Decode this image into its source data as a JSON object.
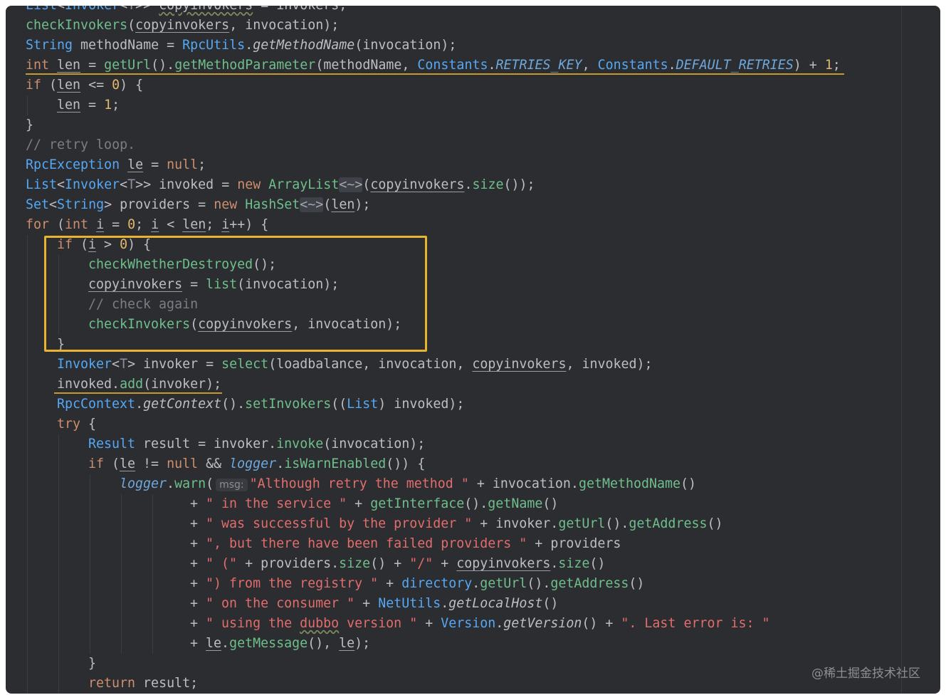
{
  "lines": [
    {
      "i": 0,
      "t": [
        [
          "ty",
          "List"
        ],
        [
          "",
          "<"
        ],
        [
          "ty",
          "Invoker"
        ],
        [
          "",
          "<"
        ],
        [
          "gen",
          "T"
        ],
        [
          "",
          ">> "
        ],
        [
          "ul wavy",
          "copyinvokers"
        ],
        [
          "",
          " = invokers;"
        ]
      ]
    },
    {
      "i": 0,
      "t": [
        [
          "fn",
          "checkInvokers"
        ],
        [
          "",
          "("
        ],
        [
          "ul",
          "copyinvokers"
        ],
        [
          "",
          ", invocation);"
        ]
      ]
    },
    {
      "i": 0,
      "t": [
        [
          "ty",
          "String"
        ],
        [
          "",
          " methodName = "
        ],
        [
          "ty",
          "RpcUtils"
        ],
        [
          "",
          "."
        ],
        [
          "it",
          "getMethodName"
        ],
        [
          "",
          "(invocation);"
        ]
      ]
    },
    {
      "i": 0,
      "t": [
        [
          "kw",
          "int"
        ],
        [
          "",
          " "
        ],
        [
          "ul",
          "len"
        ],
        [
          "",
          " = "
        ],
        [
          "fn",
          "getUrl"
        ],
        [
          "",
          "()."
        ],
        [
          "fn",
          "getMethodParameter"
        ],
        [
          "",
          "(methodName, "
        ],
        [
          "ty",
          "Constants"
        ],
        [
          "",
          "."
        ],
        [
          "cst",
          "RETRIES_KEY"
        ],
        [
          "",
          ", "
        ],
        [
          "ty",
          "Constants"
        ],
        [
          "",
          "."
        ],
        [
          "cst",
          "DEFAULT_RETRIES"
        ],
        [
          "",
          ") + "
        ],
        [
          "nu",
          "1"
        ],
        [
          "",
          ";"
        ]
      ]
    },
    {
      "i": 0,
      "t": [
        [
          "kw",
          "if"
        ],
        [
          "",
          " ("
        ],
        [
          "ul",
          "len"
        ],
        [
          "",
          " <= "
        ],
        [
          "nu",
          "0"
        ],
        [
          "",
          ") {"
        ]
      ]
    },
    {
      "i": 1,
      "t": [
        [
          "ul",
          "len"
        ],
        [
          "",
          " = "
        ],
        [
          "nu",
          "1"
        ],
        [
          "",
          ";"
        ]
      ]
    },
    {
      "i": 0,
      "t": [
        [
          "",
          "}"
        ]
      ]
    },
    {
      "i": 0,
      "t": [
        [
          "co",
          "// retry loop."
        ]
      ]
    },
    {
      "i": 0,
      "t": [
        [
          "ty",
          "RpcException"
        ],
        [
          "",
          " "
        ],
        [
          "ul",
          "le"
        ],
        [
          "",
          " = "
        ],
        [
          "kw",
          "null"
        ],
        [
          "",
          ";"
        ]
      ]
    },
    {
      "i": 0,
      "t": [
        [
          "ty",
          "List"
        ],
        [
          "",
          "<"
        ],
        [
          "ty",
          "Invoker"
        ],
        [
          "",
          "<"
        ],
        [
          "gen",
          "T"
        ],
        [
          "",
          ">> invoked = "
        ],
        [
          "kw",
          "new"
        ],
        [
          "",
          " "
        ],
        [
          "fn",
          "ArrayList"
        ],
        [
          "diamond",
          "<~>"
        ],
        [
          "",
          "("
        ],
        [
          "ul",
          "copyinvokers"
        ],
        [
          "",
          "."
        ],
        [
          "fn",
          "size"
        ],
        [
          "",
          "());"
        ]
      ]
    },
    {
      "i": 0,
      "t": [
        [
          "ty",
          "Set"
        ],
        [
          "",
          "<"
        ],
        [
          "ty",
          "String"
        ],
        [
          "",
          "> providers = "
        ],
        [
          "kw",
          "new"
        ],
        [
          "",
          " "
        ],
        [
          "fn",
          "HashSet"
        ],
        [
          "diamond",
          "<~>"
        ],
        [
          "",
          "("
        ],
        [
          "ul",
          "len"
        ],
        [
          "",
          ");"
        ]
      ]
    },
    {
      "i": 0,
      "t": [
        [
          "kw",
          "for"
        ],
        [
          "",
          " ("
        ],
        [
          "kw",
          "int"
        ],
        [
          "",
          " "
        ],
        [
          "ul",
          "i"
        ],
        [
          "",
          " = "
        ],
        [
          "nu",
          "0"
        ],
        [
          "",
          "; "
        ],
        [
          "ul",
          "i"
        ],
        [
          "",
          " < "
        ],
        [
          "ul",
          "len"
        ],
        [
          "",
          "; "
        ],
        [
          "ul",
          "i"
        ],
        [
          "",
          "++) {"
        ]
      ]
    },
    {
      "i": 1,
      "t": [
        [
          "kw",
          "if"
        ],
        [
          "",
          " ("
        ],
        [
          "ul",
          "i"
        ],
        [
          "",
          " > "
        ],
        [
          "nu",
          "0"
        ],
        [
          "",
          ") {"
        ]
      ]
    },
    {
      "i": 2,
      "t": [
        [
          "fn",
          "checkWhetherDestroyed"
        ],
        [
          "",
          "();"
        ]
      ]
    },
    {
      "i": 2,
      "t": [
        [
          "ul",
          "copyinvokers"
        ],
        [
          "",
          " = "
        ],
        [
          "fn",
          "list"
        ],
        [
          "",
          "(invocation);"
        ]
      ]
    },
    {
      "i": 2,
      "t": [
        [
          "co",
          "// check again"
        ]
      ]
    },
    {
      "i": 2,
      "t": [
        [
          "fn",
          "checkInvokers"
        ],
        [
          "",
          "("
        ],
        [
          "ul",
          "copyinvokers"
        ],
        [
          "",
          ", invocation);"
        ]
      ]
    },
    {
      "i": 1,
      "t": [
        [
          "",
          "}"
        ]
      ]
    },
    {
      "i": 1,
      "t": [
        [
          "ty",
          "Invoker"
        ],
        [
          "",
          "<"
        ],
        [
          "gen",
          "T"
        ],
        [
          "",
          "> invoker = "
        ],
        [
          "fn",
          "select"
        ],
        [
          "",
          "(loadbalance, invocation, "
        ],
        [
          "ul",
          "copyinvokers"
        ],
        [
          "",
          ", invoked);"
        ]
      ]
    },
    {
      "i": 1,
      "t": [
        [
          "",
          "invoked."
        ],
        [
          "fn",
          "add"
        ],
        [
          "",
          "(invoker);"
        ]
      ]
    },
    {
      "i": 1,
      "t": [
        [
          "ty",
          "RpcContext"
        ],
        [
          "",
          "."
        ],
        [
          "it",
          "getContext"
        ],
        [
          "",
          "()."
        ],
        [
          "fn",
          "setInvokers"
        ],
        [
          "",
          "(("
        ],
        [
          "ty",
          "List"
        ],
        [
          "",
          ") invoked);"
        ]
      ]
    },
    {
      "i": 1,
      "t": [
        [
          "kw",
          "try"
        ],
        [
          "",
          " {"
        ]
      ]
    },
    {
      "i": 2,
      "t": [
        [
          "ty",
          "Result"
        ],
        [
          "",
          " result = invoker."
        ],
        [
          "fn",
          "invoke"
        ],
        [
          "",
          "(invocation);"
        ]
      ]
    },
    {
      "i": 2,
      "t": [
        [
          "kw",
          "if"
        ],
        [
          "",
          " ("
        ],
        [
          "ul",
          "le"
        ],
        [
          "",
          " != "
        ],
        [
          "kw",
          "null"
        ],
        [
          "",
          " && "
        ],
        [
          "cst",
          "logger"
        ],
        [
          "",
          "."
        ],
        [
          "fn",
          "isWarnEnabled"
        ],
        [
          "",
          "()) {"
        ]
      ]
    },
    {
      "i": 3,
      "t": [
        [
          "cst",
          "logger"
        ],
        [
          "",
          "."
        ],
        [
          "fn",
          "warn"
        ],
        [
          "",
          "("
        ],
        [
          "hint",
          "msg:"
        ],
        [
          "st",
          "\"Although retry the method \""
        ],
        [
          "",
          " + invocation."
        ],
        [
          "fn",
          "getMethodName"
        ],
        [
          "",
          "()"
        ]
      ]
    },
    {
      "i": 5,
      "t": [
        [
          "",
          " + "
        ],
        [
          "st",
          "\" in the service \""
        ],
        [
          "",
          " + "
        ],
        [
          "fn",
          "getInterface"
        ],
        [
          "",
          "()."
        ],
        [
          "fn",
          "getName"
        ],
        [
          "",
          "()"
        ]
      ]
    },
    {
      "i": 5,
      "t": [
        [
          "",
          " + "
        ],
        [
          "st",
          "\" was successful by the provider \""
        ],
        [
          "",
          " + invoker."
        ],
        [
          "fn",
          "getUrl"
        ],
        [
          "",
          "()."
        ],
        [
          "fn",
          "getAddress"
        ],
        [
          "",
          "()"
        ]
      ]
    },
    {
      "i": 5,
      "t": [
        [
          "",
          " + "
        ],
        [
          "st",
          "\", but there have been failed providers \""
        ],
        [
          "",
          " + providers"
        ]
      ]
    },
    {
      "i": 5,
      "t": [
        [
          "",
          " + "
        ],
        [
          "st",
          "\" (\""
        ],
        [
          "",
          " + providers."
        ],
        [
          "fn",
          "size"
        ],
        [
          "",
          "() + "
        ],
        [
          "st",
          "\"/\""
        ],
        [
          "",
          " + "
        ],
        [
          "ul",
          "copyinvokers"
        ],
        [
          "",
          "."
        ],
        [
          "fn",
          "size"
        ],
        [
          "",
          "()"
        ]
      ]
    },
    {
      "i": 5,
      "t": [
        [
          "",
          " + "
        ],
        [
          "st",
          "\") from the registry \""
        ],
        [
          "",
          " + "
        ],
        [
          "ty",
          "directory"
        ],
        [
          "",
          "."
        ],
        [
          "fn",
          "getUrl"
        ],
        [
          "",
          "()."
        ],
        [
          "fn",
          "getAddress"
        ],
        [
          "",
          "()"
        ]
      ]
    },
    {
      "i": 5,
      "t": [
        [
          "",
          " + "
        ],
        [
          "st",
          "\" on the consumer \""
        ],
        [
          "",
          " + "
        ],
        [
          "ty",
          "NetUtils"
        ],
        [
          "",
          "."
        ],
        [
          "it",
          "getLocalHost"
        ],
        [
          "",
          "()"
        ]
      ]
    },
    {
      "i": 5,
      "t": [
        [
          "",
          " + "
        ],
        [
          "st",
          "\" using the "
        ],
        [
          "st wavy",
          "dubbo"
        ],
        [
          "st",
          " version \""
        ],
        [
          "",
          " + "
        ],
        [
          "ty",
          "Version"
        ],
        [
          "",
          "."
        ],
        [
          "it",
          "getVersion"
        ],
        [
          "",
          "() + "
        ],
        [
          "st",
          "\". Last error is: \""
        ]
      ]
    },
    {
      "i": 5,
      "t": [
        [
          "",
          " + "
        ],
        [
          "ul",
          "le"
        ],
        [
          "",
          "."
        ],
        [
          "fn",
          "getMessage"
        ],
        [
          "",
          "(), "
        ],
        [
          "ul",
          "le"
        ],
        [
          "",
          ");"
        ]
      ]
    },
    {
      "i": 2,
      "t": [
        [
          "",
          "}"
        ]
      ]
    },
    {
      "i": 2,
      "t": [
        [
          "kw",
          "return"
        ],
        [
          "",
          " result;"
        ]
      ]
    }
  ],
  "watermark": "@稀土掘金技术社区"
}
